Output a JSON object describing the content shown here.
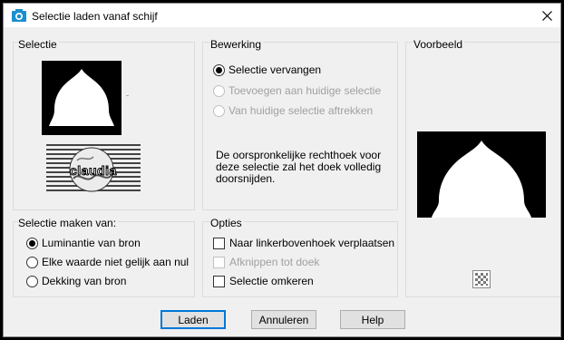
{
  "window": {
    "title": "Selectie laden vanaf schijf"
  },
  "icons": {
    "app": "camera-icon",
    "close": "close-icon",
    "transparency": "checkerboard-icon"
  },
  "selectie": {
    "label": "Selectie",
    "watermark": "claudia"
  },
  "bewerking": {
    "label": "Bewerking",
    "options": [
      {
        "label": "Selectie vervangen",
        "checked": true,
        "enabled": true
      },
      {
        "label": "Toevoegen aan huidige selectie",
        "checked": false,
        "enabled": false
      },
      {
        "label": "Van huidige selectie aftrekken",
        "checked": false,
        "enabled": false
      }
    ],
    "description": "De oorspronkelijke rechthoek voor deze selectie zal het doek volledig doorsnijden."
  },
  "voorbeeld": {
    "label": "Voorbeeld"
  },
  "selectie_maken": {
    "label": "Selectie maken van:",
    "options": [
      {
        "label": "Luminantie van bron",
        "checked": true
      },
      {
        "label": "Elke waarde niet gelijk aan nul",
        "checked": false
      },
      {
        "label": "Dekking van bron",
        "checked": false
      }
    ]
  },
  "opties": {
    "label": "Opties",
    "items": [
      {
        "label": "Naar linkerbovenhoek verplaatsen",
        "checked": false,
        "enabled": true
      },
      {
        "label": "Afknippen tot doek",
        "checked": false,
        "enabled": false
      },
      {
        "label": "Selectie omkeren",
        "checked": false,
        "enabled": true
      }
    ]
  },
  "buttons": {
    "ok": "Laden",
    "cancel": "Annuleren",
    "help": "Help"
  }
}
